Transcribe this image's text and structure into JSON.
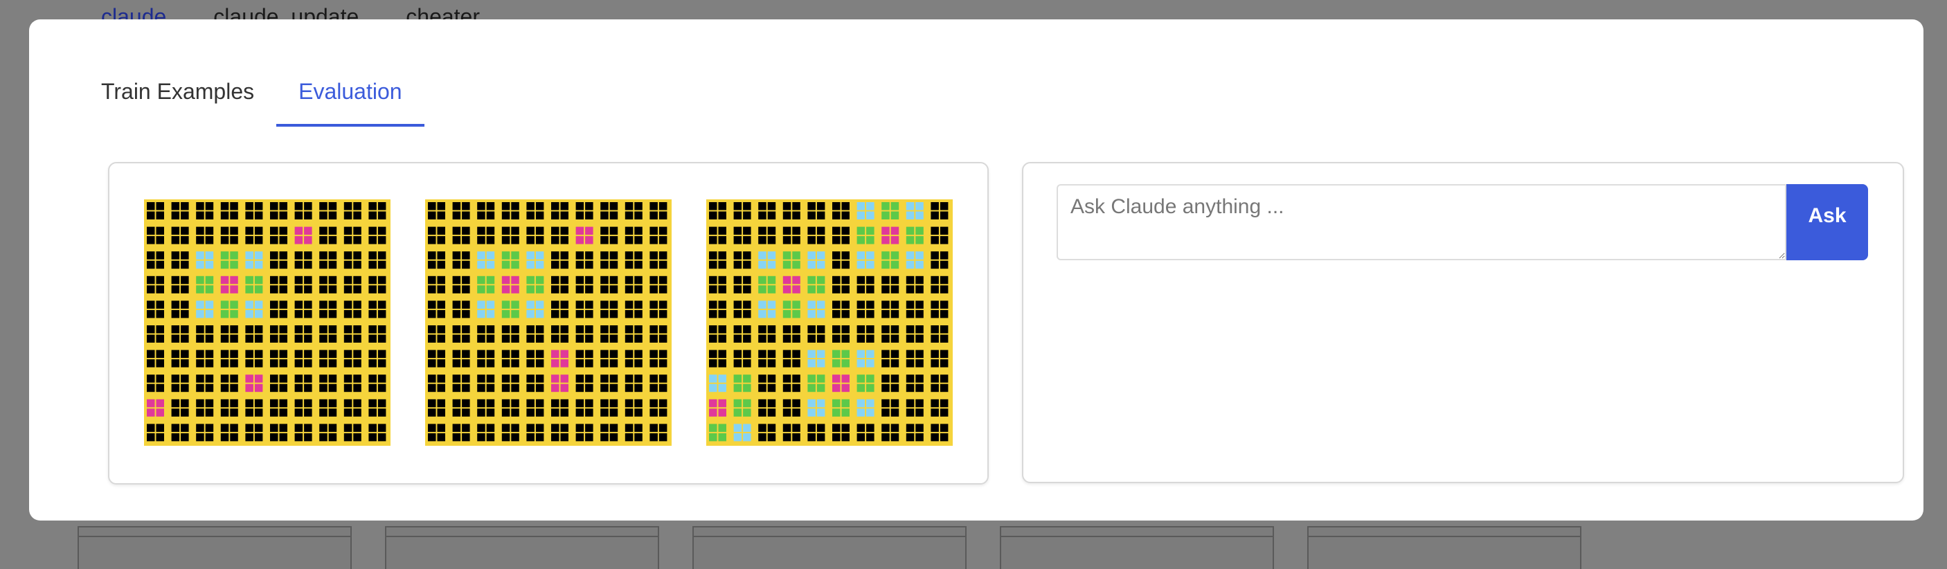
{
  "background": {
    "tabs": [
      "claude",
      "claude_update",
      "cheater"
    ]
  },
  "modal": {
    "tabs": [
      {
        "label": "Train Examples",
        "active": false
      },
      {
        "label": "Evaluation",
        "active": true
      }
    ]
  },
  "ask": {
    "placeholder": "Ask Claude anything ...",
    "button_label": "Ask"
  },
  "colors": {
    "accent": "#3b5bdb",
    "grid_0": "#000000",
    "grid_yellow": "#f5d43c",
    "grid_blue": "#87d4f5",
    "grid_green": "#5cc94a",
    "grid_magenta": "#e0399a"
  },
  "grids": [
    {
      "name": "input-grid-1",
      "blocks": [
        "KKKKKKKKKK",
        "KKKKKKMKKK",
        "KKBGBKKKKK",
        "KKGMGKKKKK",
        "KKBGBKKKKK",
        "KKKKKKKKKK",
        "KKKKKKKKKK",
        "KKKKMKKKKK",
        "MKKKKKKKKK",
        "KKKKKKKKKK"
      ]
    },
    {
      "name": "input-grid-2",
      "blocks": [
        "KKKKKKKKKK",
        "KKKKKKMKKK",
        "KKBGBKKKKK",
        "KKGMGKKKKK",
        "KKBGBKKKKK",
        "KKKKKKKKKK",
        "KKKKKMKKKK",
        "KKKKKMKKKK",
        "KKKKKKKKKK",
        "KKKKKKKKKK"
      ]
    },
    {
      "name": "output-grid",
      "blocks": [
        "KKKKKKBGBK",
        "KKKKKKGMGK",
        "KKBGBKBGBK",
        "KKGMGKKKKK",
        "KKBGBKKKKK",
        "KKKKKKKKKK",
        "KKKKBGBKKK",
        "BGKKGMGKKK",
        "MGKKBGBKKK",
        "GBKKKKKKKK"
      ]
    }
  ]
}
